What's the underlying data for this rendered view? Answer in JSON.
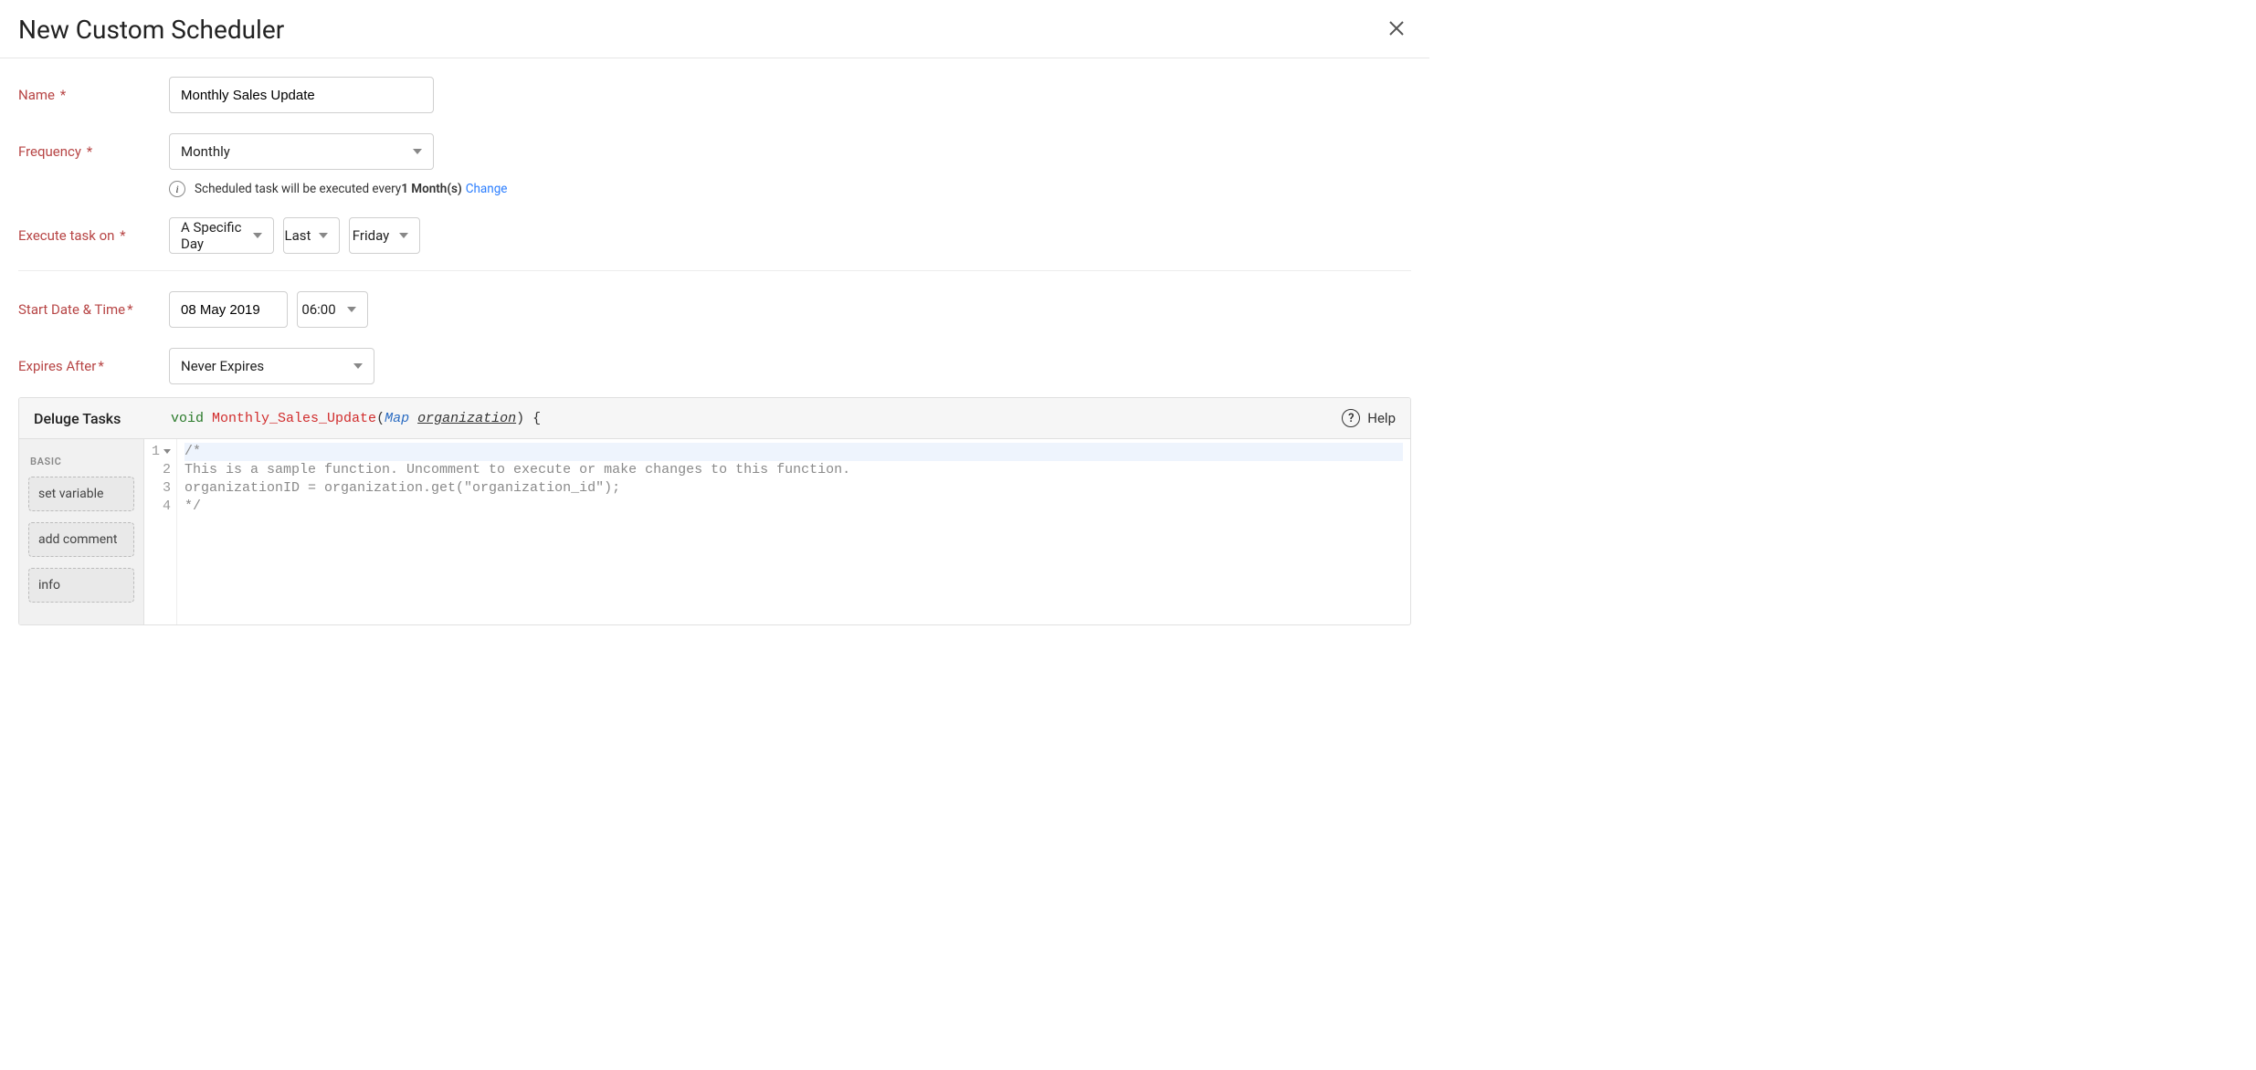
{
  "header": {
    "title": "New Custom Scheduler"
  },
  "form": {
    "name_label": "Name",
    "name_value": "Monthly Sales Update",
    "frequency_label": "Frequency",
    "frequency_value": "Monthly",
    "frequency_hint_prefix": "Scheduled task will be executed every ",
    "frequency_hint_bold": "1 Month(s)",
    "frequency_hint_change": "Change",
    "execute_label": "Execute task on",
    "execute_mode": "A Specific Day",
    "execute_ordinal": "Last",
    "execute_weekday": "Friday",
    "start_label": "Start Date & Time",
    "start_date": "08 May 2019",
    "start_time": "06:00",
    "expires_label": "Expires After",
    "expires_value": "Never Expires"
  },
  "editor": {
    "panel_title": "Deluge Tasks",
    "signature": {
      "kw_void": "void",
      "fn_name": "Monthly_Sales_Update",
      "type_name": "Map",
      "param_name": "organization",
      "open_paren": "(",
      "close_paren_brace": ") {"
    },
    "help_label": "Help",
    "sidebar": {
      "category": "Basic",
      "tasks": [
        "set variable",
        "add comment",
        "info"
      ]
    },
    "code_lines": [
      "/*",
      "This is a sample function. Uncomment to execute or make changes to this function.",
      "organizationID = organization.get(\"organization_id\");",
      "*/"
    ],
    "line_numbers": [
      "1",
      "2",
      "3",
      "4"
    ]
  }
}
